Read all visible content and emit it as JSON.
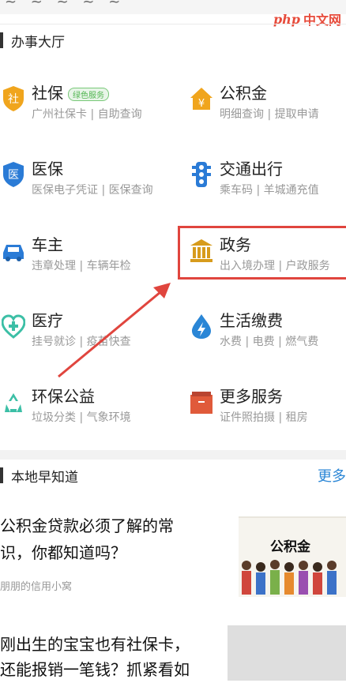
{
  "watermark": {
    "php": "php",
    "cn": "中文网"
  },
  "section1": {
    "title": "办事大厅"
  },
  "services": [
    {
      "name": "社保",
      "badge": "绿色服务",
      "sub": "广州社保卡 | 自助查询",
      "icon": "shield-icon",
      "color": "#f0a51d"
    },
    {
      "name": "公积金",
      "sub": "明细查询 | 提取申请",
      "icon": "house-yen-icon",
      "color": "#f0a51d"
    },
    {
      "name": "医保",
      "sub": "医保电子凭证 | 医保查询",
      "icon": "shield-medical-icon",
      "color": "#2a7bd6"
    },
    {
      "name": "交通出行",
      "sub": "乘车码 | 羊城通充值",
      "icon": "traffic-light-icon",
      "color": "#2a7bd6"
    },
    {
      "name": "车主",
      "sub": "违章处理 | 车辆年检",
      "icon": "car-icon",
      "color": "#2a7bd6"
    },
    {
      "name": "政务",
      "sub": "出入境办理 | 户政服务",
      "icon": "government-building-icon",
      "color": "#d79b1c"
    },
    {
      "name": "医疗",
      "sub": "挂号就诊 | 疫苗快查",
      "icon": "medical-heart-icon",
      "color": "#3cbfa6"
    },
    {
      "name": "生活缴费",
      "sub": "水费 | 电费 | 燃气费",
      "icon": "lightning-drop-icon",
      "color": "#2a86d6"
    },
    {
      "name": "环保公益",
      "sub": "垃圾分类 | 气象环境",
      "icon": "recycle-icon",
      "color": "#3cbfa6"
    },
    {
      "name": "更多服务",
      "sub": "证件照拍摄 | 租房",
      "icon": "more-box-icon",
      "color": "#e05a3a"
    }
  ],
  "section2": {
    "title": "本地早知道",
    "more": "更多"
  },
  "articles": [
    {
      "title_line1": "公积金贷款必须了解的常",
      "title_line2": "识，你都知道吗？",
      "source": "朋朋的信用小窝",
      "thumb_label": "公积金"
    },
    {
      "title_line1": "刚出生的宝宝也有社保卡，",
      "title_line2": "还能报销一笔钱？抓紧看如"
    }
  ]
}
